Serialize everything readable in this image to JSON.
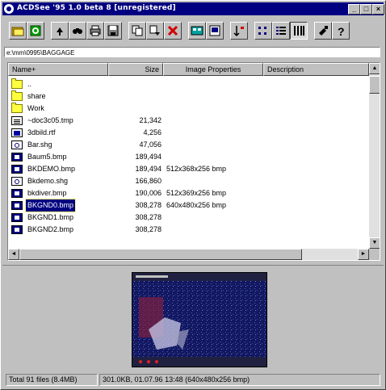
{
  "window": {
    "title": "ACDSee '95 1.0 beta 8 [unregistered]",
    "minimize_glyph": "_",
    "maximize_glyph": "□",
    "close_glyph": "×"
  },
  "toolbar": {
    "buttons": [
      {
        "name": "open-folder-icon"
      },
      {
        "name": "refresh-icon"
      },
      {
        "name": "up-folder-icon"
      },
      {
        "name": "find-icon"
      },
      {
        "name": "print-icon"
      },
      {
        "name": "save-icon"
      },
      {
        "name": "copy-icon"
      },
      {
        "name": "move-icon"
      },
      {
        "name": "delete-icon"
      },
      {
        "name": "thumbnails-icon"
      },
      {
        "name": "large-icons-icon"
      },
      {
        "name": "sort-icon"
      },
      {
        "name": "small-icons-icon"
      },
      {
        "name": "list-view-icon"
      },
      {
        "name": "details-view-icon"
      },
      {
        "name": "options-icon"
      },
      {
        "name": "help-icon"
      }
    ]
  },
  "path": "e:\\mm\\0995\\BAGGAGE",
  "columns": {
    "name": "Name+",
    "size": "Size",
    "props": "Image Properties",
    "desc": "Description"
  },
  "files": [
    {
      "icon": "folder",
      "name": "..",
      "size": "",
      "props": ""
    },
    {
      "icon": "folder",
      "name": "share",
      "size": "",
      "props": ""
    },
    {
      "icon": "folder",
      "name": "Work",
      "size": "",
      "props": ""
    },
    {
      "icon": "file",
      "name": "~doc3c05.tmp",
      "size": "21,342",
      "props": ""
    },
    {
      "icon": "rtf",
      "name": "3dbild.rtf",
      "size": "4,256",
      "props": ""
    },
    {
      "icon": "shg",
      "name": "Bar.shg",
      "size": "47,056",
      "props": ""
    },
    {
      "icon": "bmp",
      "name": "Baum5.bmp",
      "size": "189,494",
      "props": ""
    },
    {
      "icon": "bmp",
      "name": "BKDEMO.bmp",
      "size": "189,494",
      "props": "512x368x256 bmp"
    },
    {
      "icon": "shg",
      "name": "Bkdemo.shg",
      "size": "166,860",
      "props": ""
    },
    {
      "icon": "bmp",
      "name": "bkdiver.bmp",
      "size": "190,006",
      "props": "512x369x256 bmp"
    },
    {
      "icon": "bmp",
      "name": "BKGND0.bmp",
      "size": "308,278",
      "props": "640x480x256 bmp",
      "selected": true
    },
    {
      "icon": "bmp",
      "name": "BKGND1.bmp",
      "size": "308,278",
      "props": ""
    },
    {
      "icon": "bmp",
      "name": "BKGND2.bmp",
      "size": "308,278",
      "props": ""
    }
  ],
  "status": {
    "total": "Total 91 files (8.4MB)",
    "selected": "301.0KB, 01.07.96 13:48 (640x480x256 bmp)"
  }
}
